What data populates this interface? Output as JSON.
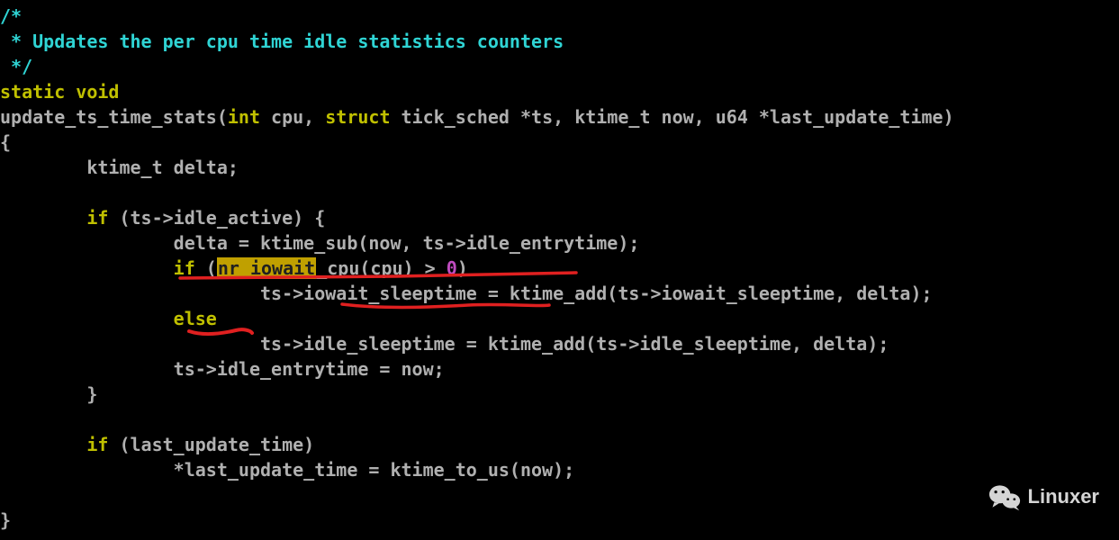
{
  "code": {
    "comment_open": "/*",
    "comment_body": " * Updates the per cpu time idle statistics counters",
    "comment_close": " */",
    "kw_static": "static",
    "kw_void": "void",
    "fn_name": "update_ts_time_stats",
    "sig_open": "(",
    "kw_int": "int",
    "sig_cpu": " cpu, ",
    "kw_struct": "struct",
    "sig_ts": " tick_sched *ts, ktime_t now, u64 *last_update_time)",
    "brace_open": "{",
    "decl": "        ktime_t delta;",
    "blank": "",
    "if1_indent": "        ",
    "kw_if": "if",
    "if1_cond": " (ts->idle_active) {",
    "l_delta": "                delta = ktime_sub(now, ts->idle_entrytime);",
    "if2_indent": "                ",
    "if2_open": " (",
    "hl_nr_iowait": "nr_iowait",
    "if2_after_hl": "_cpu(cpu) > ",
    "num_zero": "0",
    "if2_close": ")",
    "l_iowait": "                        ts->iowait_sleeptime = ktime_add(ts->iowait_sleeptime, delta);",
    "else_indent": "                ",
    "kw_else": "else",
    "l_idle": "                        ts->idle_sleeptime = ktime_add(ts->idle_sleeptime, delta);",
    "l_entry": "                ts->idle_entrytime = now;",
    "if1_close": "        }",
    "if3_indent": "        ",
    "if3_cond": " (last_update_time)",
    "l_last": "                *last_update_time = ktime_to_us(now);",
    "brace_close": "}"
  },
  "watermark": {
    "label": "Linuxer"
  }
}
